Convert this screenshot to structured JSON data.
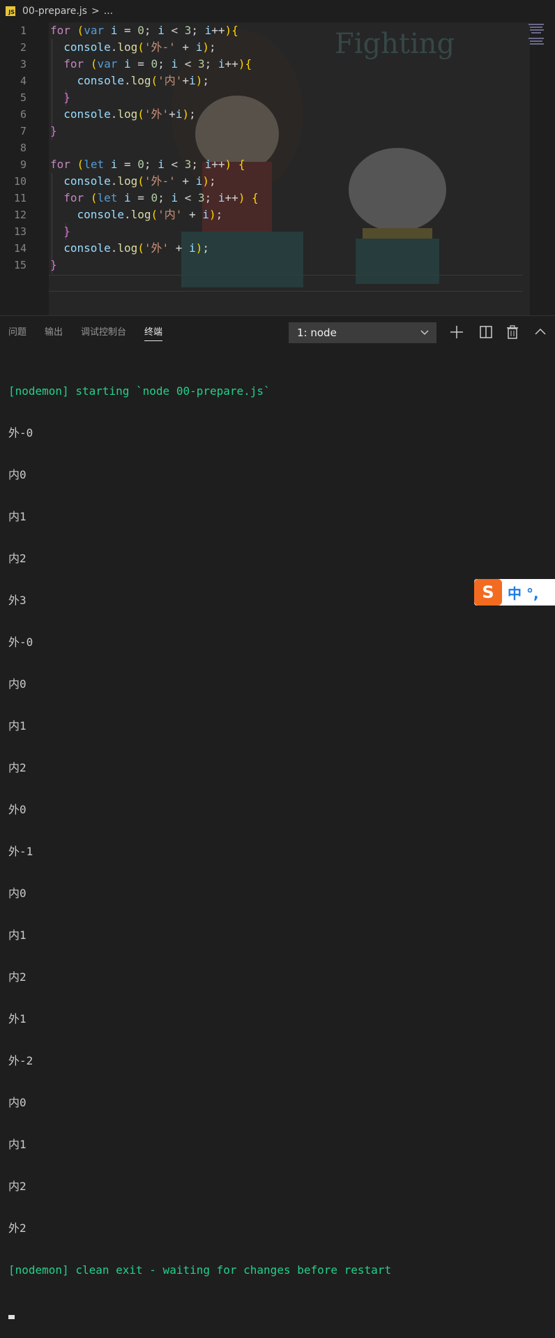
{
  "breadcrumb": {
    "file_icon": "JS",
    "filename": "00-prepare.js",
    "separator": ">",
    "more": "..."
  },
  "editor": {
    "line_numbers": [
      "1",
      "2",
      "3",
      "4",
      "5",
      "6",
      "7",
      "8",
      "9",
      "10",
      "11",
      "12",
      "13",
      "14",
      "15"
    ],
    "lines": [
      "for (var i = 0; i < 3; i++){",
      "  console.log('外-' + i);",
      "  for (var i = 0; i < 3; i++){",
      "    console.log('内'+i);",
      "  }",
      "  console.log('外'+i);",
      "}",
      "",
      "for (let i = 0; i < 3; i++) {",
      "  console.log('外-' + i);",
      "  for (let i = 0; i < 3; i++) {",
      "    console.log('内' + i);",
      "  }",
      "  console.log('外' + i);",
      "}"
    ],
    "wallpaper_text": "Fighting"
  },
  "panel": {
    "tabs": [
      "问题",
      "输出",
      "调试控制台",
      "终端"
    ],
    "active_tab": "终端",
    "terminal_select": "1: node",
    "icons": [
      "chevron-down-icon",
      "plus-icon",
      "split-icon",
      "trash-icon",
      "chevron-up-icon"
    ]
  },
  "terminal": {
    "start_line": "[nodemon] starting `node 00-prepare.js`",
    "output": [
      "外-0",
      "内0",
      "内1",
      "内2",
      "外3",
      "外-0",
      "内0",
      "内1",
      "内2",
      "外0",
      "外-1",
      "内0",
      "内1",
      "内2",
      "外1",
      "外-2",
      "内0",
      "内1",
      "内2",
      "外2"
    ],
    "end_line": "[nodemon] clean exit - waiting for changes before restart"
  },
  "ime": {
    "logo": "S",
    "text": "中 °, "
  }
}
